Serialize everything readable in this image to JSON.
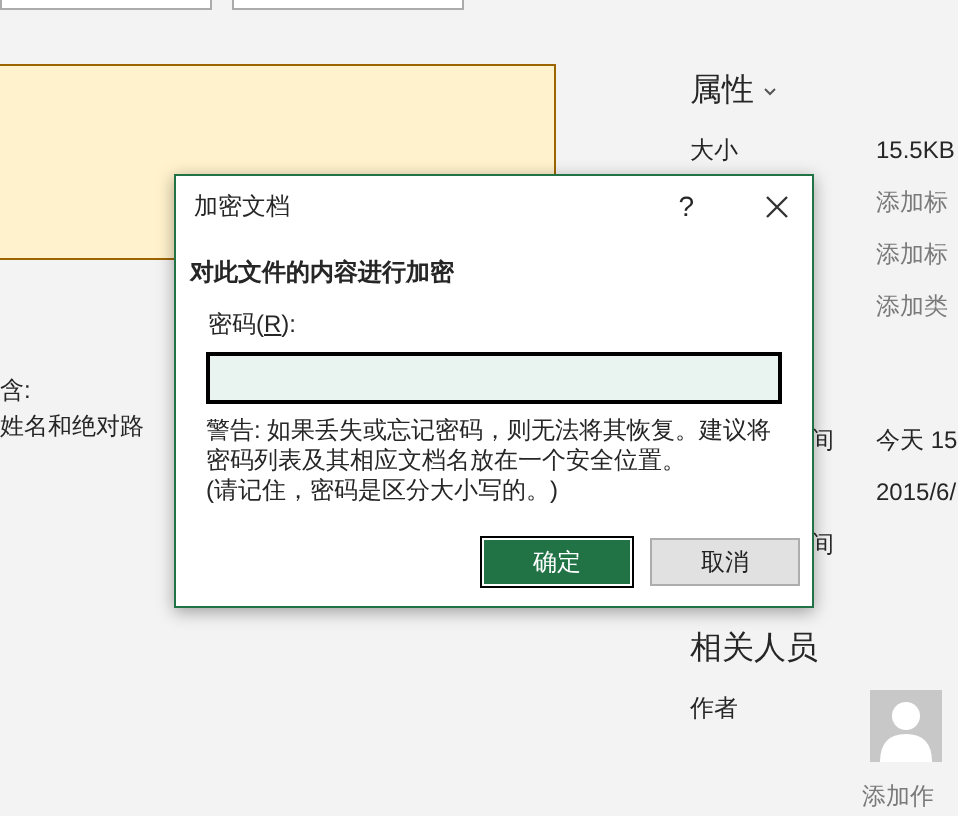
{
  "left_text": [
    "含:",
    "姓名和绝对路"
  ],
  "properties": {
    "title": "属性",
    "rows": [
      {
        "label": "大小",
        "value": "15.5KB",
        "kind": "text"
      },
      {
        "value": "添加标",
        "kind": "link"
      },
      {
        "value": "添加标",
        "kind": "link"
      },
      {
        "value": "添加类",
        "kind": "link"
      },
      {
        "kind": "gap"
      },
      {
        "label": "间",
        "value": "今天 15",
        "kind": "covered"
      },
      {
        "value": "2015/6/",
        "kind": "text"
      },
      {
        "label": "间",
        "kind": "covered"
      }
    ]
  },
  "related_people": {
    "title": "相关人员",
    "author_label": "作者",
    "add_author": "添加作"
  },
  "dialog": {
    "title": "加密文档",
    "help": "?",
    "heading": "对此文件的内容进行加密",
    "field_label": "密码(",
    "access_key": "R",
    "field_label_end": "):",
    "warning": "警告: 如果丢失或忘记密码，则无法将其恢复。建议将密码列表及其相应文档名放在一个安全位置。",
    "note": "(请记住，密码是区分大小写的。)",
    "buttons": [
      {
        "label": "确定",
        "default": true
      },
      {
        "label": "取消",
        "default": false
      }
    ]
  }
}
